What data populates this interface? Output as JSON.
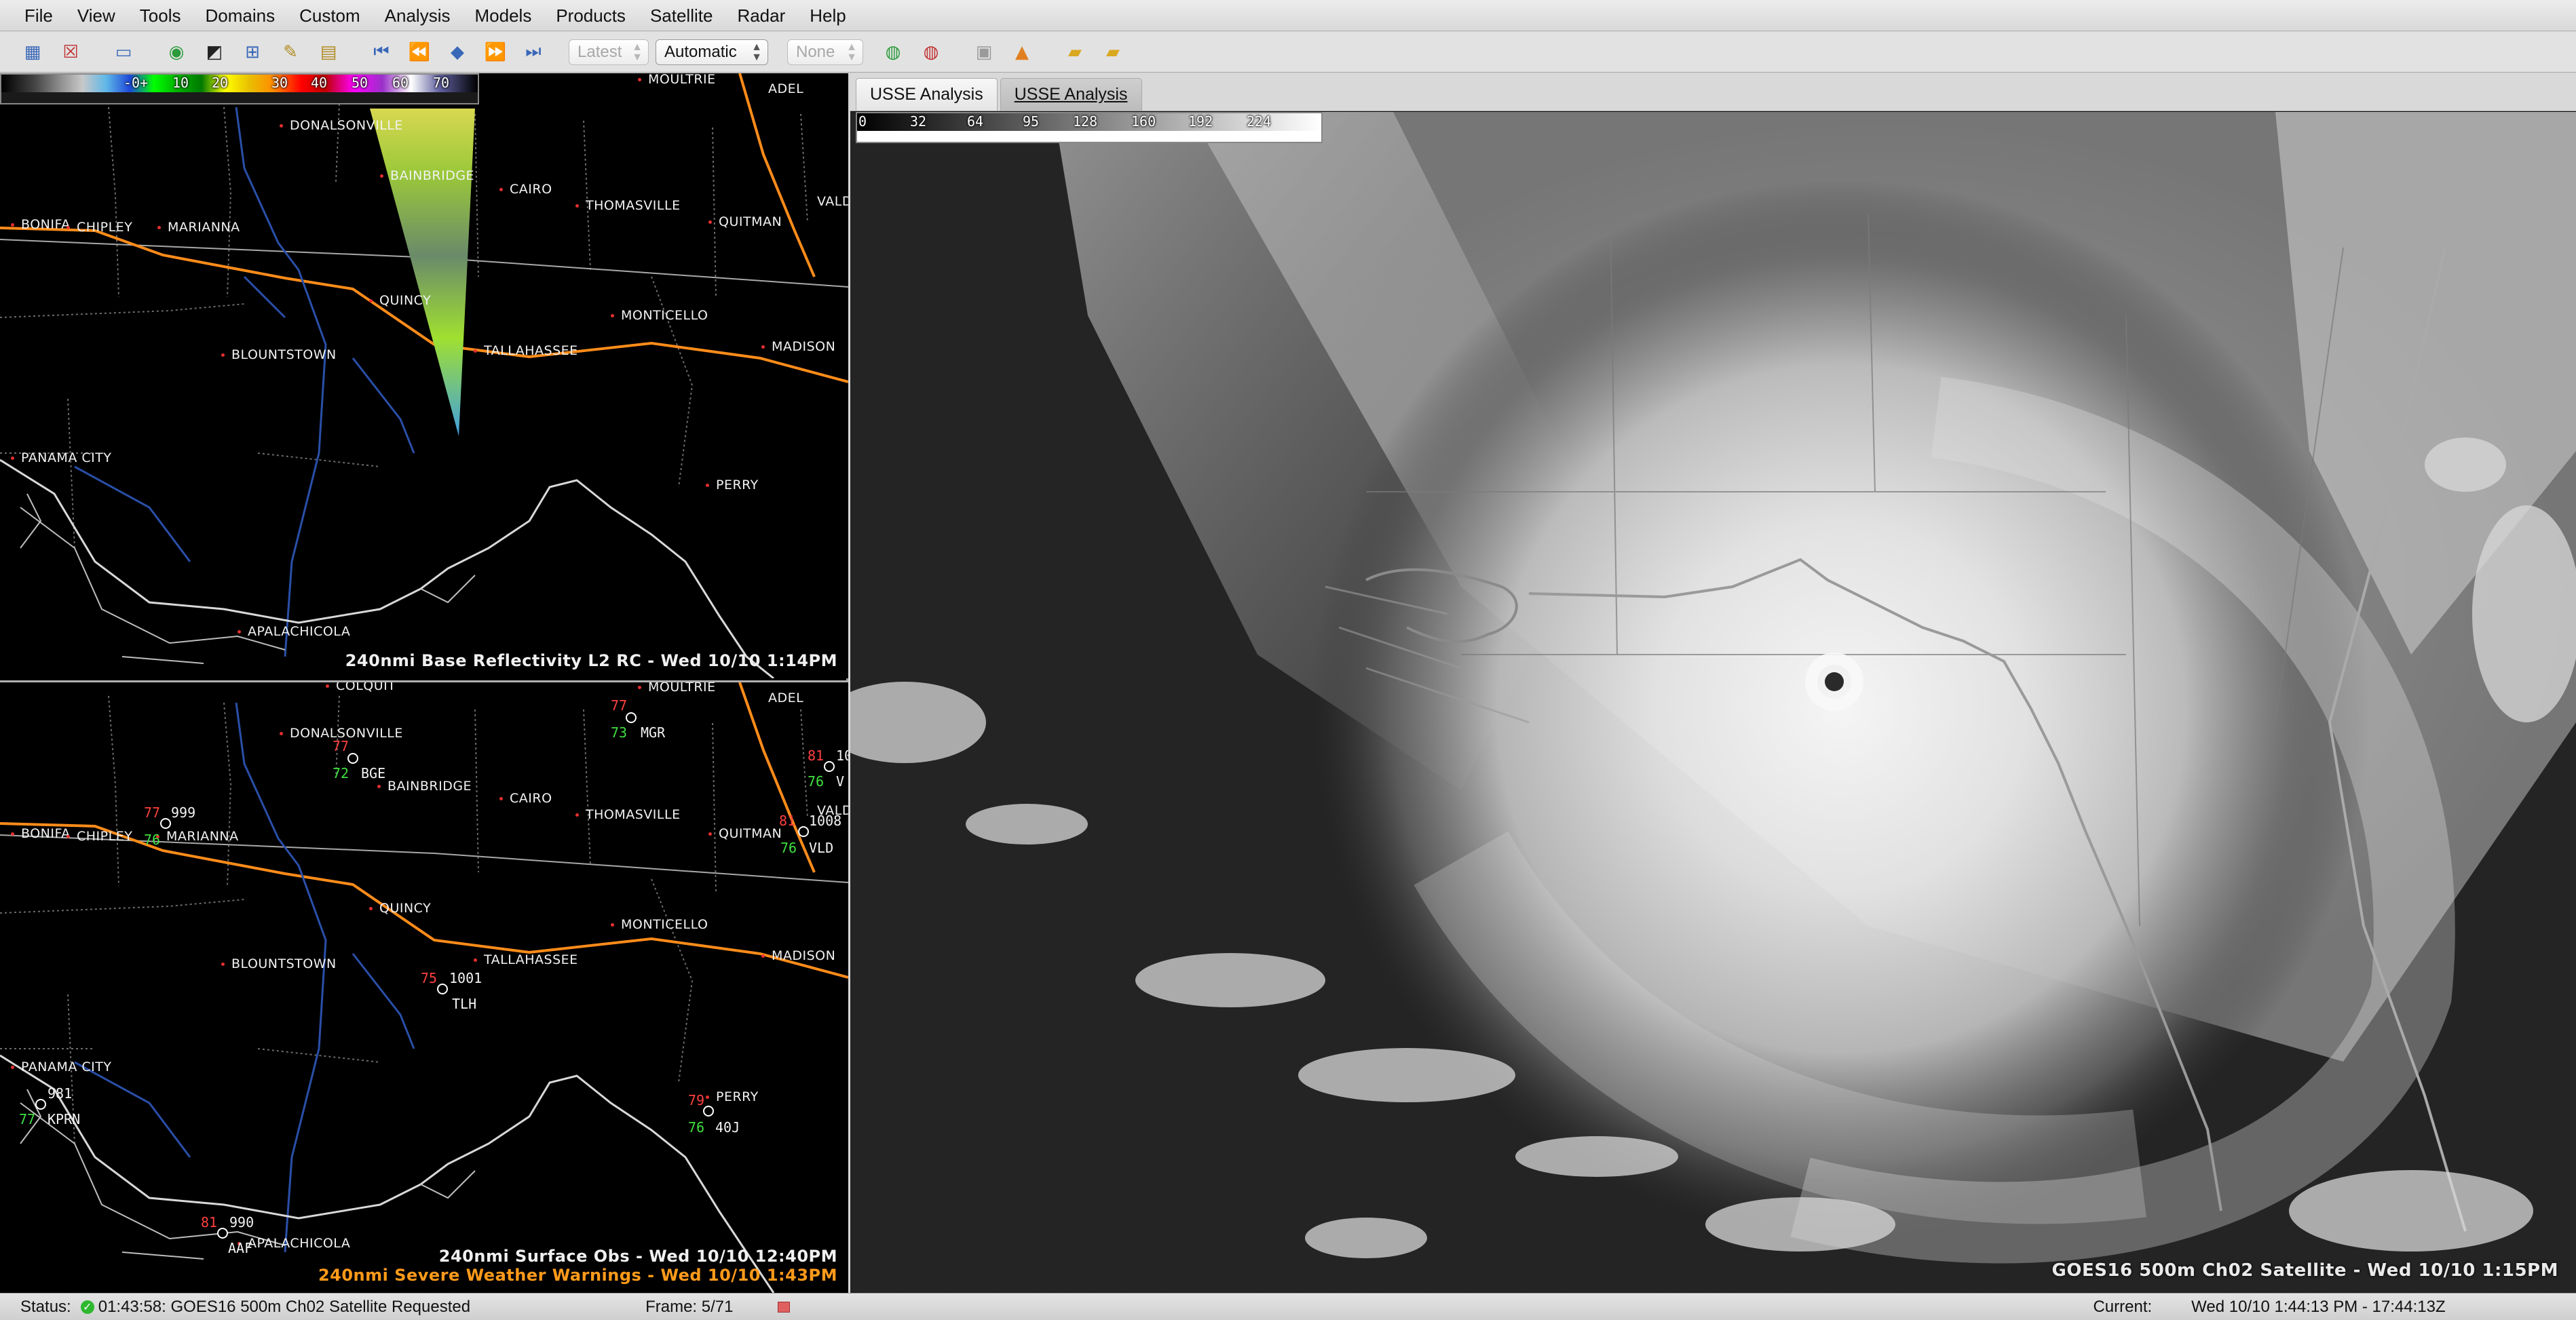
{
  "menubar": {
    "items": [
      "File",
      "View",
      "Tools",
      "Domains",
      "Custom",
      "Analysis",
      "Models",
      "Products",
      "Satellite",
      "Radar",
      "Help"
    ]
  },
  "toolbar": {
    "frame_select": "Latest",
    "mode_select": "Automatic",
    "none_select": "None",
    "icons": [
      "new-map-icon",
      "close-map-icon",
      "panel-layout-icon",
      "refresh-globe-icon",
      "image-properties-icon",
      "zoom-icon",
      "edit-icon",
      "color-edit-icon",
      "first-frame-icon",
      "step-back-icon",
      "stop-icon",
      "step-forward-icon",
      "last-frame-icon",
      "link-icon",
      "unlink-icon",
      "camera-icon",
      "warning-icon",
      "folder-open-icon",
      "folder-save-icon"
    ]
  },
  "radar_panel": {
    "scale_labels": [
      "-0+",
      "10",
      "20",
      "30",
      "40",
      "50",
      "60",
      "70"
    ],
    "cities": [
      "MOULTRIE",
      "ADEL",
      "DONALSONVILLE",
      "BAINBRIDGE",
      "CAIRO",
      "THOMASVILLE",
      "QUITMAN",
      "VALD",
      "BONIFA",
      "CHIPLEY",
      "MARIANNA",
      "QUINCY",
      "MONTICELLO",
      "BLOUNTSTOWN",
      "TALLAHASSEE",
      "MADISON",
      "PANAMA CITY",
      "PERRY",
      "APALACHICOLA"
    ],
    "caption": "240nmi Base Reflectivity L2 RC - Wed 10/10 1:14PM"
  },
  "obs_panel": {
    "cities": [
      "COLQUIT",
      "MOULTRIE",
      "ADEL",
      "DONALSONVILLE",
      "BAINBRIDGE",
      "CAIRO",
      "THOMASVILLE",
      "QUITMAN",
      "VALD",
      "BONIFA",
      "CHIPLEY",
      "MARIANNA",
      "QUINCY",
      "MONTICELLO",
      "BLOUNTSTOWN",
      "TALLAHASSEE",
      "MADISON",
      "PANAMA CITY",
      "PERRY",
      "APALACHICOLA"
    ],
    "stations": [
      {
        "temp": "77",
        "dew": "73",
        "pres": "",
        "id": "MGR"
      },
      {
        "temp": "77",
        "dew": "72",
        "pres": "",
        "id": "BGE"
      },
      {
        "temp": "77",
        "dew": "76",
        "pres": "999",
        "id": ""
      },
      {
        "temp": "81",
        "dew": "76",
        "pres": "10",
        "id": "V"
      },
      {
        "temp": "81",
        "dew": "76",
        "pres": "1008",
        "id": "VLD"
      },
      {
        "temp": "75",
        "dew": "",
        "pres": "1001",
        "id": "TLH"
      },
      {
        "temp": "",
        "dew": "77",
        "pres": "981",
        "id": "KPRN"
      },
      {
        "temp": "79",
        "dew": "76",
        "pres": "",
        "id": "40J"
      },
      {
        "temp": "81",
        "dew": "",
        "pres": "990",
        "id": "AAF"
      }
    ],
    "caption_obs": "240nmi Surface Obs - Wed 10/10 12:40PM",
    "caption_warn": "240nmi Severe Weather Warnings - Wed 10/10 1:43PM"
  },
  "satellite_panel": {
    "tabs": [
      {
        "label": "USSE Analysis",
        "active": false
      },
      {
        "label": "USSE Analysis",
        "active": true
      }
    ],
    "scale_labels": [
      "0",
      "32",
      "64",
      "95",
      "128",
      "160",
      "192",
      "224"
    ],
    "caption": "GOES16 500m Ch02 Satellite - Wed 10/10 1:15PM"
  },
  "statusbar": {
    "label": "Status:",
    "message": "01:43:58: GOES16 500m Ch02 Satellite Requested",
    "frame": "Frame: 5/71",
    "current_label": "Current:",
    "current_time": "Wed 10/10 1:44:13 PM - 17:44:13Z"
  },
  "colors": {
    "interstate": "#ff8c1a",
    "rivers": "#2a4fa8",
    "coast": "#d8d8d8",
    "warn_caption": "#ff9a1a"
  }
}
